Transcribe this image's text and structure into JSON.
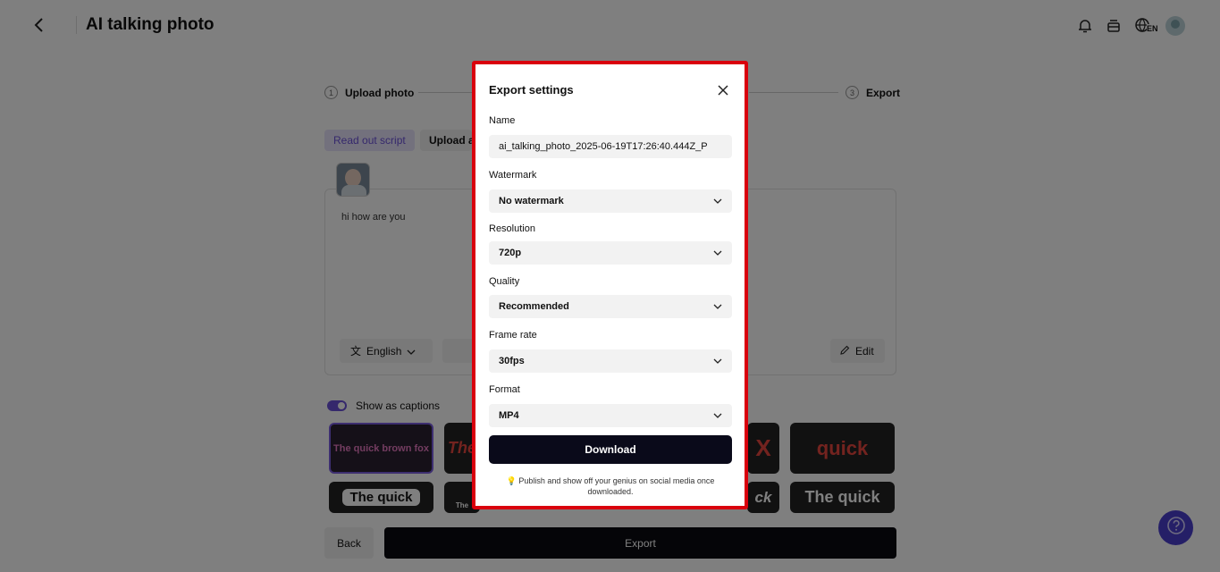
{
  "header": {
    "title": "AI talking photo",
    "language_badge": "EN"
  },
  "steps": [
    {
      "num": "1",
      "label": "Upload photo"
    },
    {
      "num": "3",
      "label": "Export"
    }
  ],
  "script_tabs": {
    "read_out": "Read out script",
    "upload_audio": "Upload audio"
  },
  "script": {
    "text": "hi how are you",
    "language": "English",
    "edit_label": "Edit"
  },
  "captions": {
    "label": "Show as captions",
    "enabled": true
  },
  "caption_styles": [
    {
      "text": "The quick brown fox",
      "color": "#e779c1"
    },
    {
      "text": "The",
      "color": "#e6463f"
    },
    {
      "text": "X",
      "color": "#e6463f"
    },
    {
      "text": "quick",
      "color": "#e6463f"
    },
    {
      "text": "The quick",
      "color": "#111111"
    },
    {
      "text": "The",
      "color": "#ffffff"
    },
    {
      "text": "ck",
      "color": "#ffffff"
    },
    {
      "text": "The quick",
      "color": "#ffffff"
    }
  ],
  "footer": {
    "back": "Back",
    "export": "Export"
  },
  "modal": {
    "title": "Export settings",
    "name_label": "Name",
    "name_value": "ai_talking_photo_2025-06-19T17:26:40.444Z_P",
    "watermark_label": "Watermark",
    "watermark_value": "No watermark",
    "resolution_label": "Resolution",
    "resolution_value": "720p",
    "quality_label": "Quality",
    "quality_value": "Recommended",
    "framerate_label": "Frame rate",
    "framerate_value": "30fps",
    "format_label": "Format",
    "format_value": "MP4",
    "download": "Download",
    "tip_icon": "lightbulb-icon",
    "tip": "Publish and show off your genius on social media once downloaded."
  },
  "colors": {
    "accent": "#6a50d8",
    "modal_border": "#d9000d",
    "primary_button": "#0a0a1a"
  }
}
